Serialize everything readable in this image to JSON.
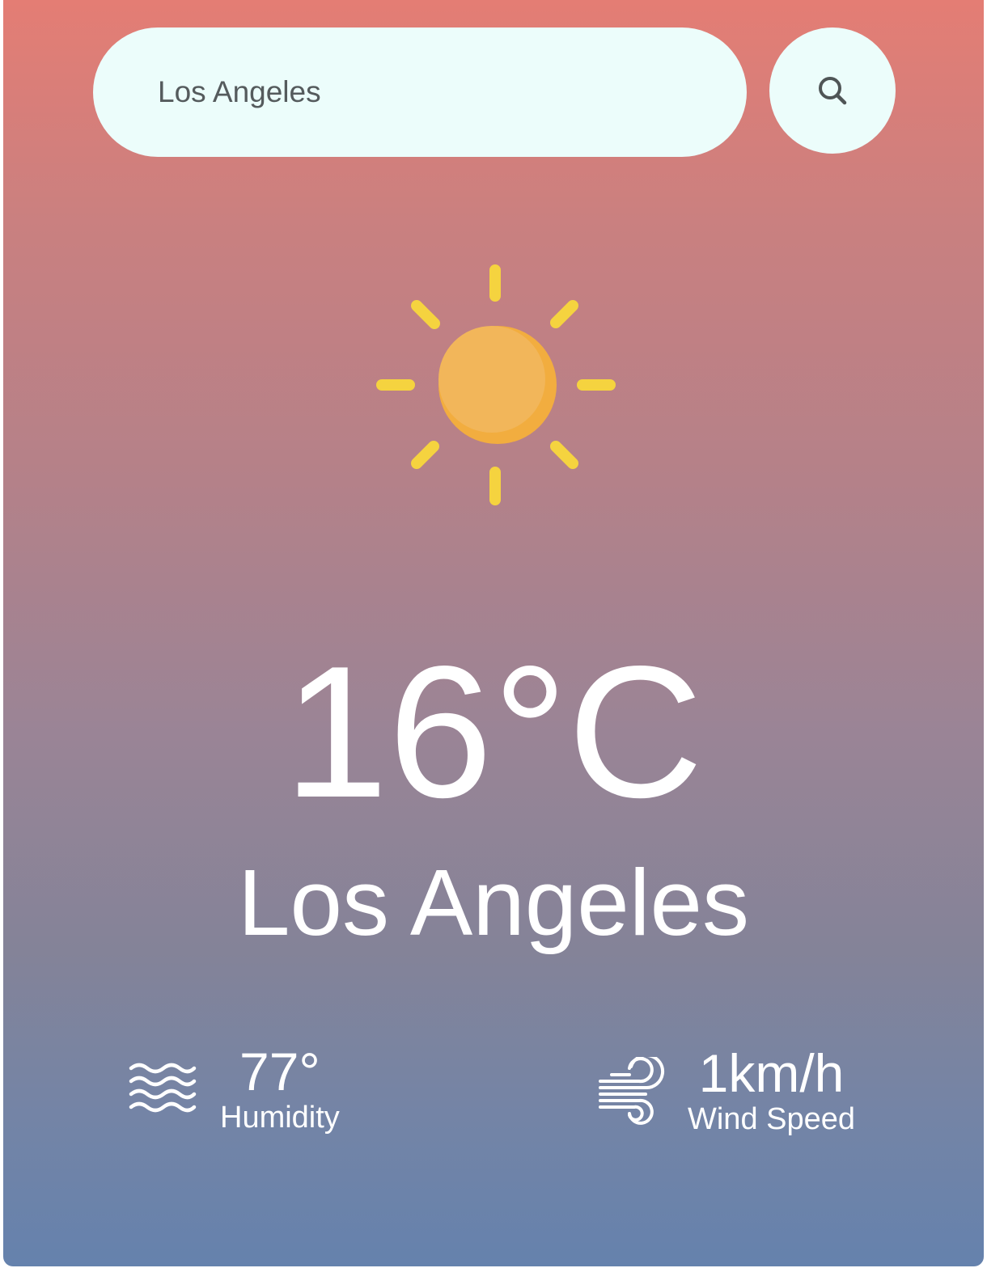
{
  "search": {
    "value": "Los Angeles",
    "button_icon": "search-icon"
  },
  "weather": {
    "icon": "sun-icon",
    "temperature": "16°C",
    "city": "Los Angeles"
  },
  "details": {
    "humidity": {
      "icon": "humidity-icon",
      "value": "77°",
      "label": "Humidity"
    },
    "wind": {
      "icon": "wind-icon",
      "value": "1km/h",
      "label": "Wind Speed"
    }
  },
  "colors": {
    "gradient_top": "#e47d74",
    "gradient_bottom": "#6582ad",
    "search_background": "#ecfdfb",
    "sun_rays": "#f5d33f",
    "sun_body": "#f2b65a",
    "text": "#ffffff"
  }
}
